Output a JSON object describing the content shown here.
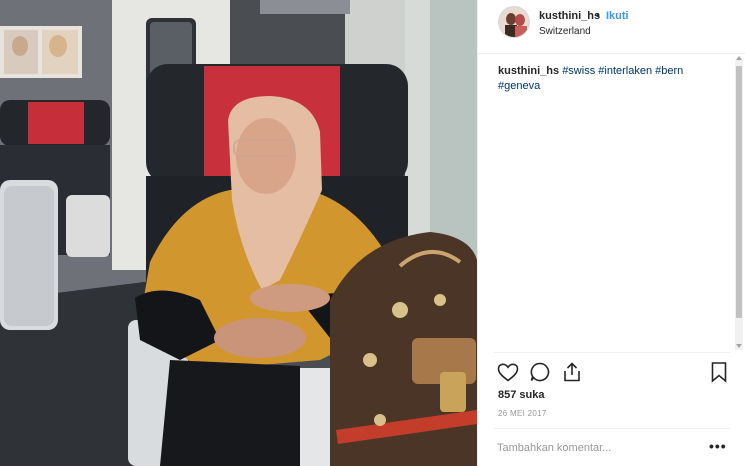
{
  "post": {
    "photo_icon": "post-photo",
    "header": {
      "avatar_icon": "avatar",
      "username": "kusthini_hs",
      "separator": "•",
      "follow_label": "Ikuti",
      "location": "Switzerland"
    },
    "caption": {
      "username": "kusthini_hs",
      "hashtags": [
        "#swiss",
        "#interlaken",
        "#bern",
        "#geneva"
      ]
    },
    "actions": {
      "like_icon": "heart-icon",
      "comment_icon": "comment-icon",
      "share_icon": "share-icon",
      "save_icon": "bookmark-icon"
    },
    "likes": "857 suka",
    "date": "26 MEI 2017",
    "comment": {
      "placeholder": "Tambahkan komentar...",
      "value": "",
      "more_label": "•••"
    }
  },
  "colors": {
    "link_blue": "#3897f0",
    "hashtag_blue": "#003569",
    "text": "#262626",
    "muted": "#999999",
    "border": "#efefef"
  }
}
